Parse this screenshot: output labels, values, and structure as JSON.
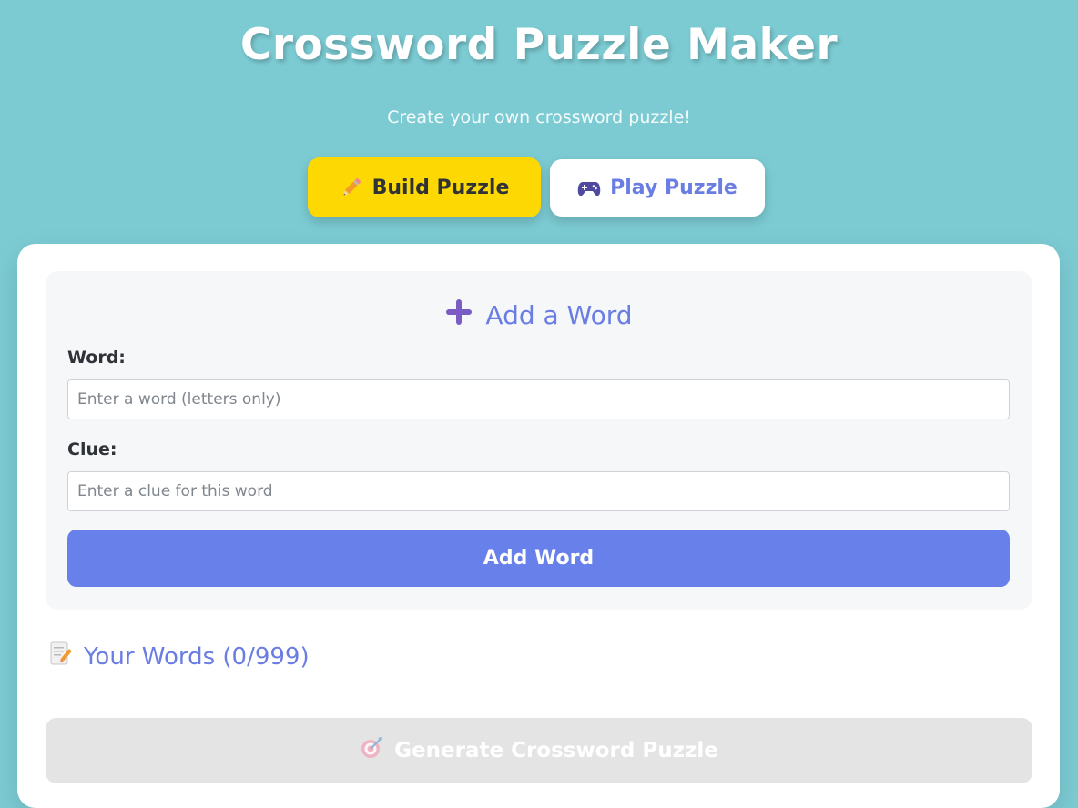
{
  "header": {
    "title": "Crossword Puzzle Maker",
    "subtitle": "Create your own crossword puzzle!"
  },
  "mode_tabs": [
    {
      "label": "Build Puzzle",
      "icon": "pencil-icon",
      "active": true
    },
    {
      "label": "Play Puzzle",
      "icon": "game-controller-icon",
      "active": false
    }
  ],
  "add_word": {
    "title": "Add a Word",
    "icon": "plus-icon",
    "word_label": "Word:",
    "word_value": "",
    "word_placeholder": "Enter a word (letters only)",
    "clue_label": "Clue:",
    "clue_value": "",
    "clue_placeholder": "Enter a clue for this word",
    "button_label": "Add Word"
  },
  "words": {
    "heading": "Your Words (0/999)",
    "icon": "memo-icon",
    "items": []
  },
  "generate": {
    "label": "Generate Crossword Puzzle",
    "icon": "target-icon",
    "disabled": true
  },
  "colors": {
    "background": "#7ccbd3",
    "accent": "#6880ea",
    "build_tab": "#fdd803",
    "heading_text": "#6a7de3",
    "disabled": "#e4e4e4"
  }
}
